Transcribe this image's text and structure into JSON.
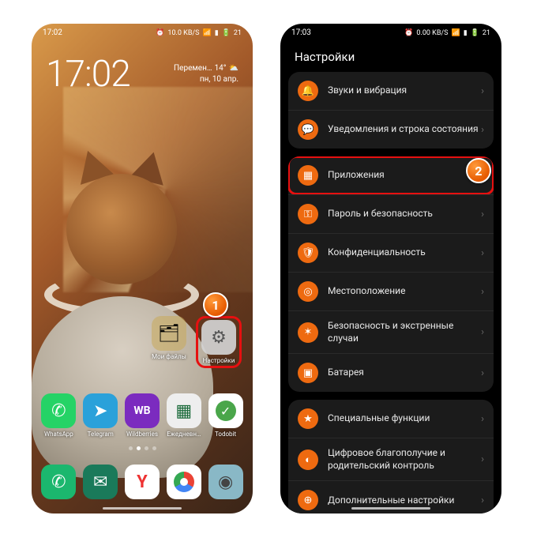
{
  "left": {
    "status": {
      "time": "17:02",
      "speed": "10.0 KB/S",
      "battery": "21"
    },
    "clock": "17:02",
    "weather": {
      "cond": "Перемен…",
      "temp": "14°",
      "date": "пн, 10 апр."
    },
    "mid": {
      "folder": "Мои файлы",
      "settings": "Настройки"
    },
    "apps": [
      {
        "n": "WhatsApp",
        "k": "whatsapp",
        "g": "✆"
      },
      {
        "n": "Telegram",
        "k": "telegram",
        "g": "➤"
      },
      {
        "n": "Wildberries",
        "k": "wb",
        "g": "WB"
      },
      {
        "n": "Ежедневн…",
        "k": "cal",
        "g": "▦"
      },
      {
        "n": "Todobit",
        "k": "todo",
        "g": "✓"
      }
    ],
    "dock": [
      {
        "k": "phone",
        "g": "✆"
      },
      {
        "k": "msg",
        "g": "✉"
      },
      {
        "k": "yandex",
        "g": "Y"
      },
      {
        "k": "chrome",
        "g": ""
      },
      {
        "k": "cam",
        "g": "◉"
      }
    ]
  },
  "right": {
    "status": {
      "time": "17:03",
      "speed": "0.00 KB/S",
      "battery": "21"
    },
    "title": "Настройки",
    "group1": [
      {
        "k": "sound",
        "i": "🔔",
        "t": "Звуки и вибрация"
      },
      {
        "k": "notif",
        "i": "💬",
        "t": "Уведомления и строка состояния"
      }
    ],
    "group2": [
      {
        "k": "apps",
        "i": "▦",
        "t": "Приложения",
        "hl": true
      },
      {
        "k": "security",
        "i": "⚿",
        "t": "Пароль и безопасность"
      },
      {
        "k": "privacy",
        "i": "🛡",
        "t": "Конфиденциальность"
      },
      {
        "k": "location",
        "i": "◎",
        "t": "Местоположение"
      },
      {
        "k": "emergency",
        "i": "✶",
        "t": "Безопасность и экстренные случаи"
      },
      {
        "k": "battery",
        "i": "▣",
        "t": "Батарея"
      }
    ],
    "group3": [
      {
        "k": "special",
        "i": "★",
        "t": "Специальные функции"
      },
      {
        "k": "wellbeing",
        "i": "◐",
        "t": "Цифровое благополучие и родительский контроль"
      },
      {
        "k": "more",
        "i": "⊕",
        "t": "Дополнительные настройки"
      }
    ]
  },
  "badges": {
    "b1": "1",
    "b2": "2"
  }
}
